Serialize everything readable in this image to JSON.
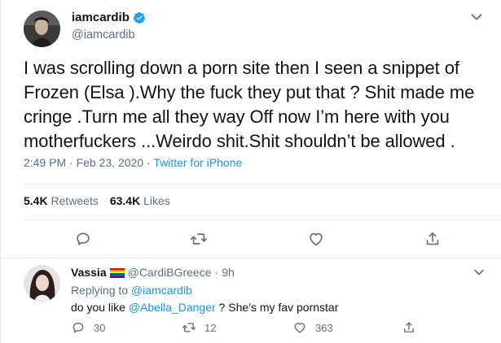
{
  "main_tweet": {
    "display_name": "iamcardib",
    "handle": "@iamcardib",
    "text": "I was scrolling down a porn site then I seen a snippet of Frozen (Elsa ).Why the fuck they put that ? Shit made me cringe .Turn me all they way Off now I’m here with you motherfuckers ...Weirdo shit.Shit shouldn’t be allowed .",
    "time": "2:49 PM",
    "date": "Feb 23, 2020",
    "separator": "·",
    "source": "Twitter for iPhone",
    "retweets_count": "5.4K",
    "retweets_label": "Retweets",
    "likes_count": "63.4K",
    "likes_label": "Likes"
  },
  "reply": {
    "display_name": "Vassia",
    "handle": "@CardiBGreece",
    "separator": "·",
    "time": "9h",
    "replying_prefix": "Replying to",
    "replying_to": "@iamcardib",
    "text_before": "do you like ",
    "mention": "@Abella_Danger",
    "text_after": " ? She’s my fav pornstar",
    "reply_count": "30",
    "retweet_count": "12",
    "like_count": "363"
  },
  "colors": {
    "verified": "#1da1f2",
    "link": "#1b95e0",
    "secondary_text": "#5b7083",
    "divider": "#e6ecf0"
  },
  "icons": [
    "verified-icon",
    "more-icon",
    "reply-icon",
    "retweet-icon",
    "like-icon",
    "share-icon",
    "rainbow-flag-icon"
  ]
}
